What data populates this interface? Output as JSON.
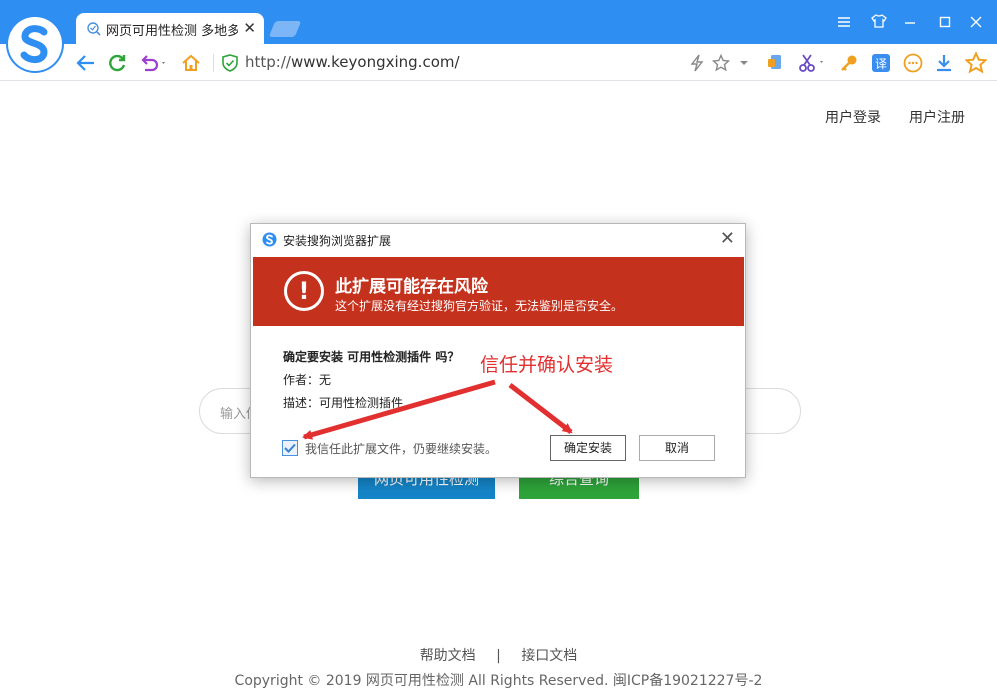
{
  "browser": {
    "tab": {
      "title": "网页可用性检测 多地多线",
      "favicon": "search-globe-icon"
    },
    "url": {
      "protocol": "http://",
      "host": "www.keyongxing.com/"
    },
    "window_controls": [
      "menu-icon",
      "skin-icon",
      "minimize-icon",
      "maximize-icon",
      "close-icon"
    ],
    "toolbar_icons": [
      "back-icon",
      "refresh-icon",
      "undo-icon",
      "home-icon",
      "shield-icon",
      "lightning-icon",
      "star-icon",
      "dropdown-icon",
      "extension-icon",
      "scissors-icon",
      "key-icon",
      "translate-icon",
      "emoji-icon",
      "download-icon",
      "favorites-icon"
    ],
    "accent": "#2f8ef2"
  },
  "page": {
    "login": "用户登录",
    "register": "用户注册",
    "search_placeholder": "输入你",
    "check_button": "网页可用性检测",
    "query_button": "综合查询",
    "footer_help": "帮助文档",
    "footer_divider": "|",
    "footer_api": "接口文档",
    "copyright": "Copyright © 2019   网页可用性检测   All Rights Reserved.   闽ICP备19021227号-2",
    "colors": {
      "check_button": "#1585c8",
      "query_button": "#2ea43a"
    }
  },
  "dialog": {
    "title": "安装搜狗浏览器扩展",
    "warning_title": "此扩展可能存在风险",
    "warning_desc": "这个扩展没有经过搜狗官方验证，无法鉴别是否安全。",
    "question": "确定要安装 可用性检测插件 吗？",
    "author": "作者：无",
    "description": "描述：可用性检测插件",
    "trust_label": "我信任此扩展文件，仍要继续安装。",
    "trust_checked": true,
    "confirm": "确定安装",
    "cancel": "取消",
    "warning_color": "#c4311d"
  },
  "annotation": {
    "text": "信任并确认安装",
    "color": "#e23030"
  }
}
